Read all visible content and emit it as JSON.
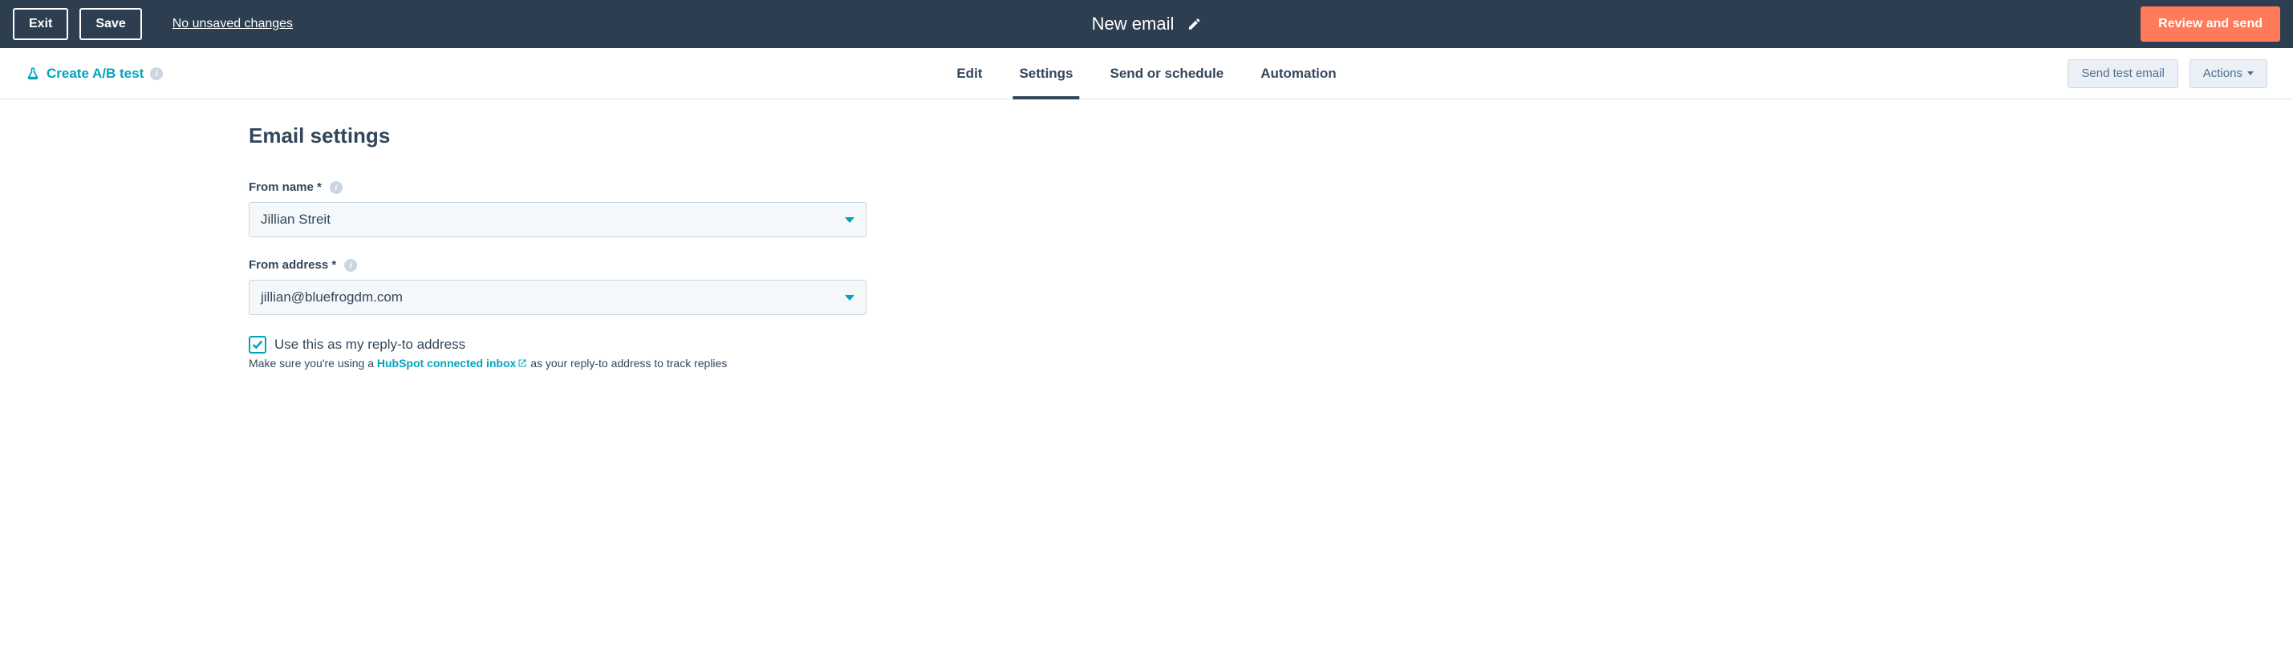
{
  "topbar": {
    "exit_label": "Exit",
    "save_label": "Save",
    "unsaved_text": "No unsaved changes",
    "title": "New email",
    "review_label": "Review and send"
  },
  "navbar": {
    "ab_test_label": "Create A/B test",
    "tabs": {
      "edit": "Edit",
      "settings": "Settings",
      "send": "Send or schedule",
      "automation": "Automation"
    },
    "send_test_label": "Send test email",
    "actions_label": "Actions"
  },
  "content": {
    "heading": "Email settings",
    "from_name_label": "From name *",
    "from_name_value": "Jillian Streit",
    "from_address_label": "From address *",
    "from_address_value": "jillian@bluefrogdm.com",
    "reply_to_checkbox_label": "Use this as my reply-to address",
    "help_prefix": "Make sure you're using a ",
    "help_link_text": "HubSpot connected inbox",
    "help_suffix": " as your reply-to address to track replies"
  }
}
